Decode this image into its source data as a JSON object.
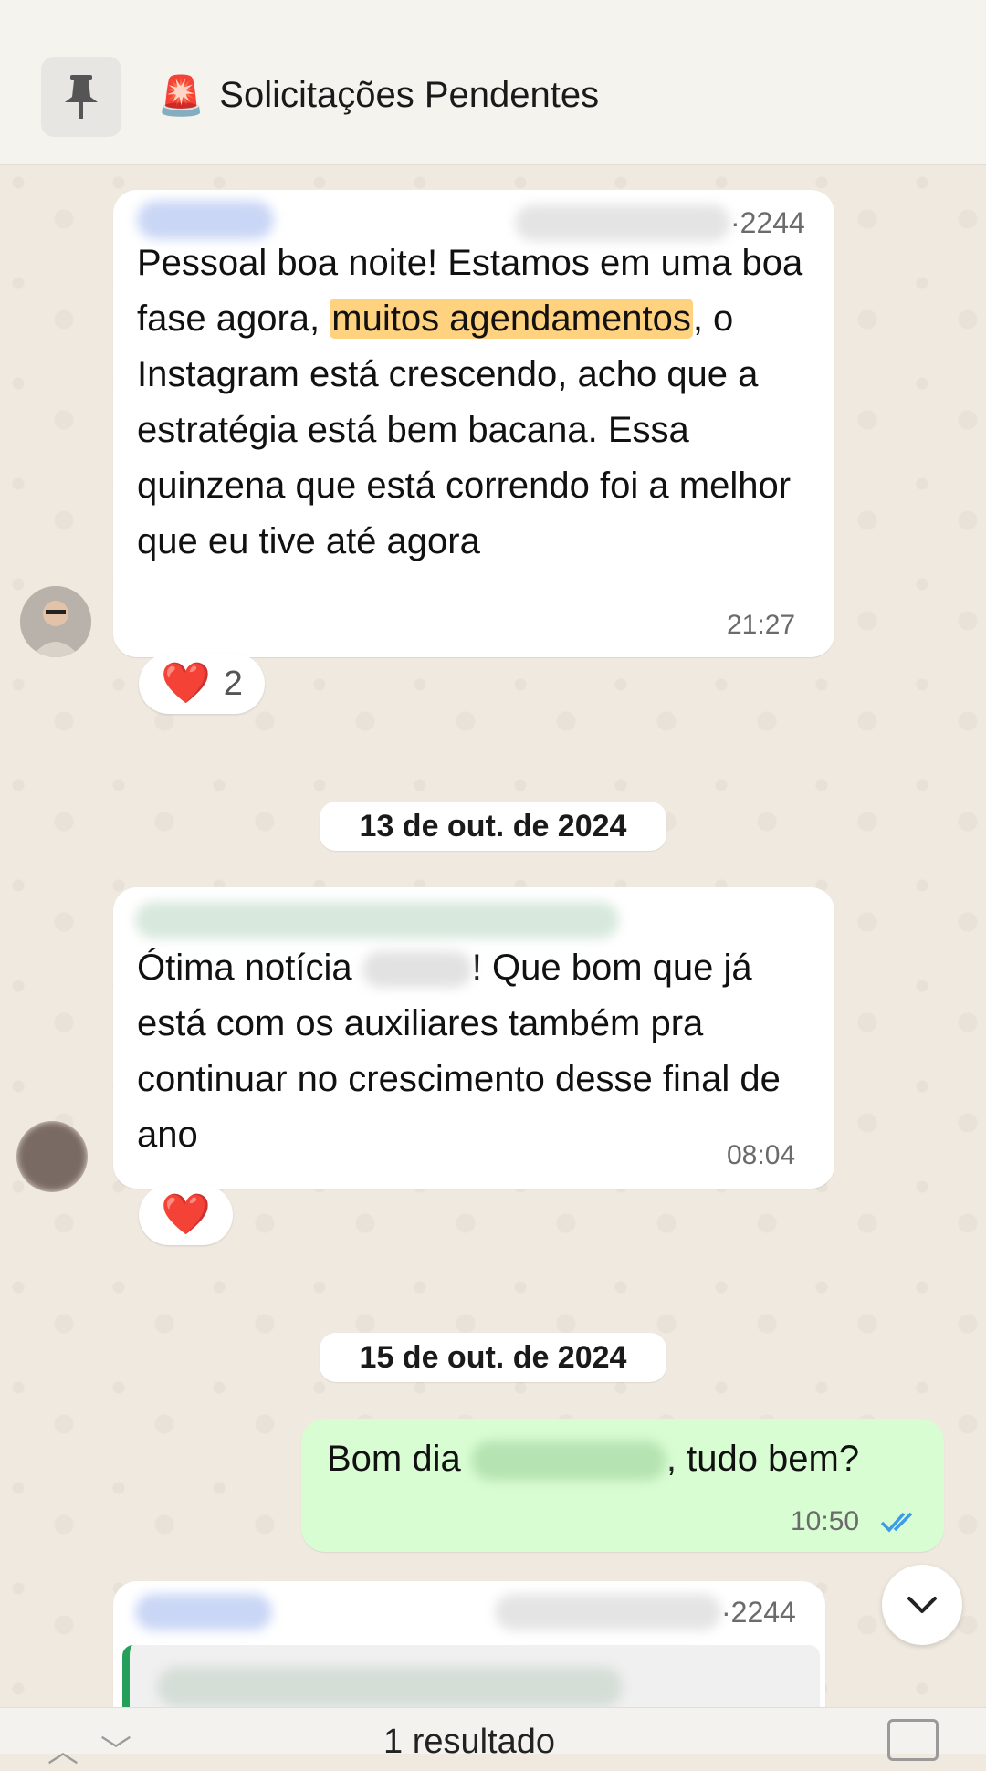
{
  "header": {
    "title": "Solicitações Pendentes",
    "title_emoji": "🚨",
    "pin_icon": "pin-icon"
  },
  "messages": [
    {
      "sender_phone_suffix": "2244",
      "text_before": "Pessoal boa noite! Estamos em uma boa fase agora, ",
      "highlight": "muitos agendamentos",
      "text_after": ", o Instagram está crescendo, acho que a estratégia está bem bacana.  Essa quinzena que está correndo foi a melhor que eu tive até agora",
      "time": "21:27",
      "reaction_emoji": "❤️",
      "reaction_count": "2"
    },
    {
      "date": "13 de out. de 2024"
    },
    {
      "text_before": "Ótima notícia ",
      "text_after": "! Que bom que já está com os auxiliares também pra continuar no crescimento desse final de ano",
      "time": "08:04",
      "reaction_emoji": "❤️"
    },
    {
      "date": "15 de out. de 2024"
    },
    {
      "outgoing": true,
      "text_before": "Bom dia ",
      "text_after": ", tudo bem?",
      "time": "10:50",
      "status": "read"
    },
    {
      "sender_phone_suffix": "2244"
    }
  ],
  "bottom_bar": {
    "results_label": "1 resultado"
  },
  "colors": {
    "background": "#efe9df",
    "incoming_bubble": "#ffffff",
    "outgoing_bubble": "#d9fdd3",
    "highlight": "#ffd27f",
    "read_ticks": "#3d9be9"
  }
}
